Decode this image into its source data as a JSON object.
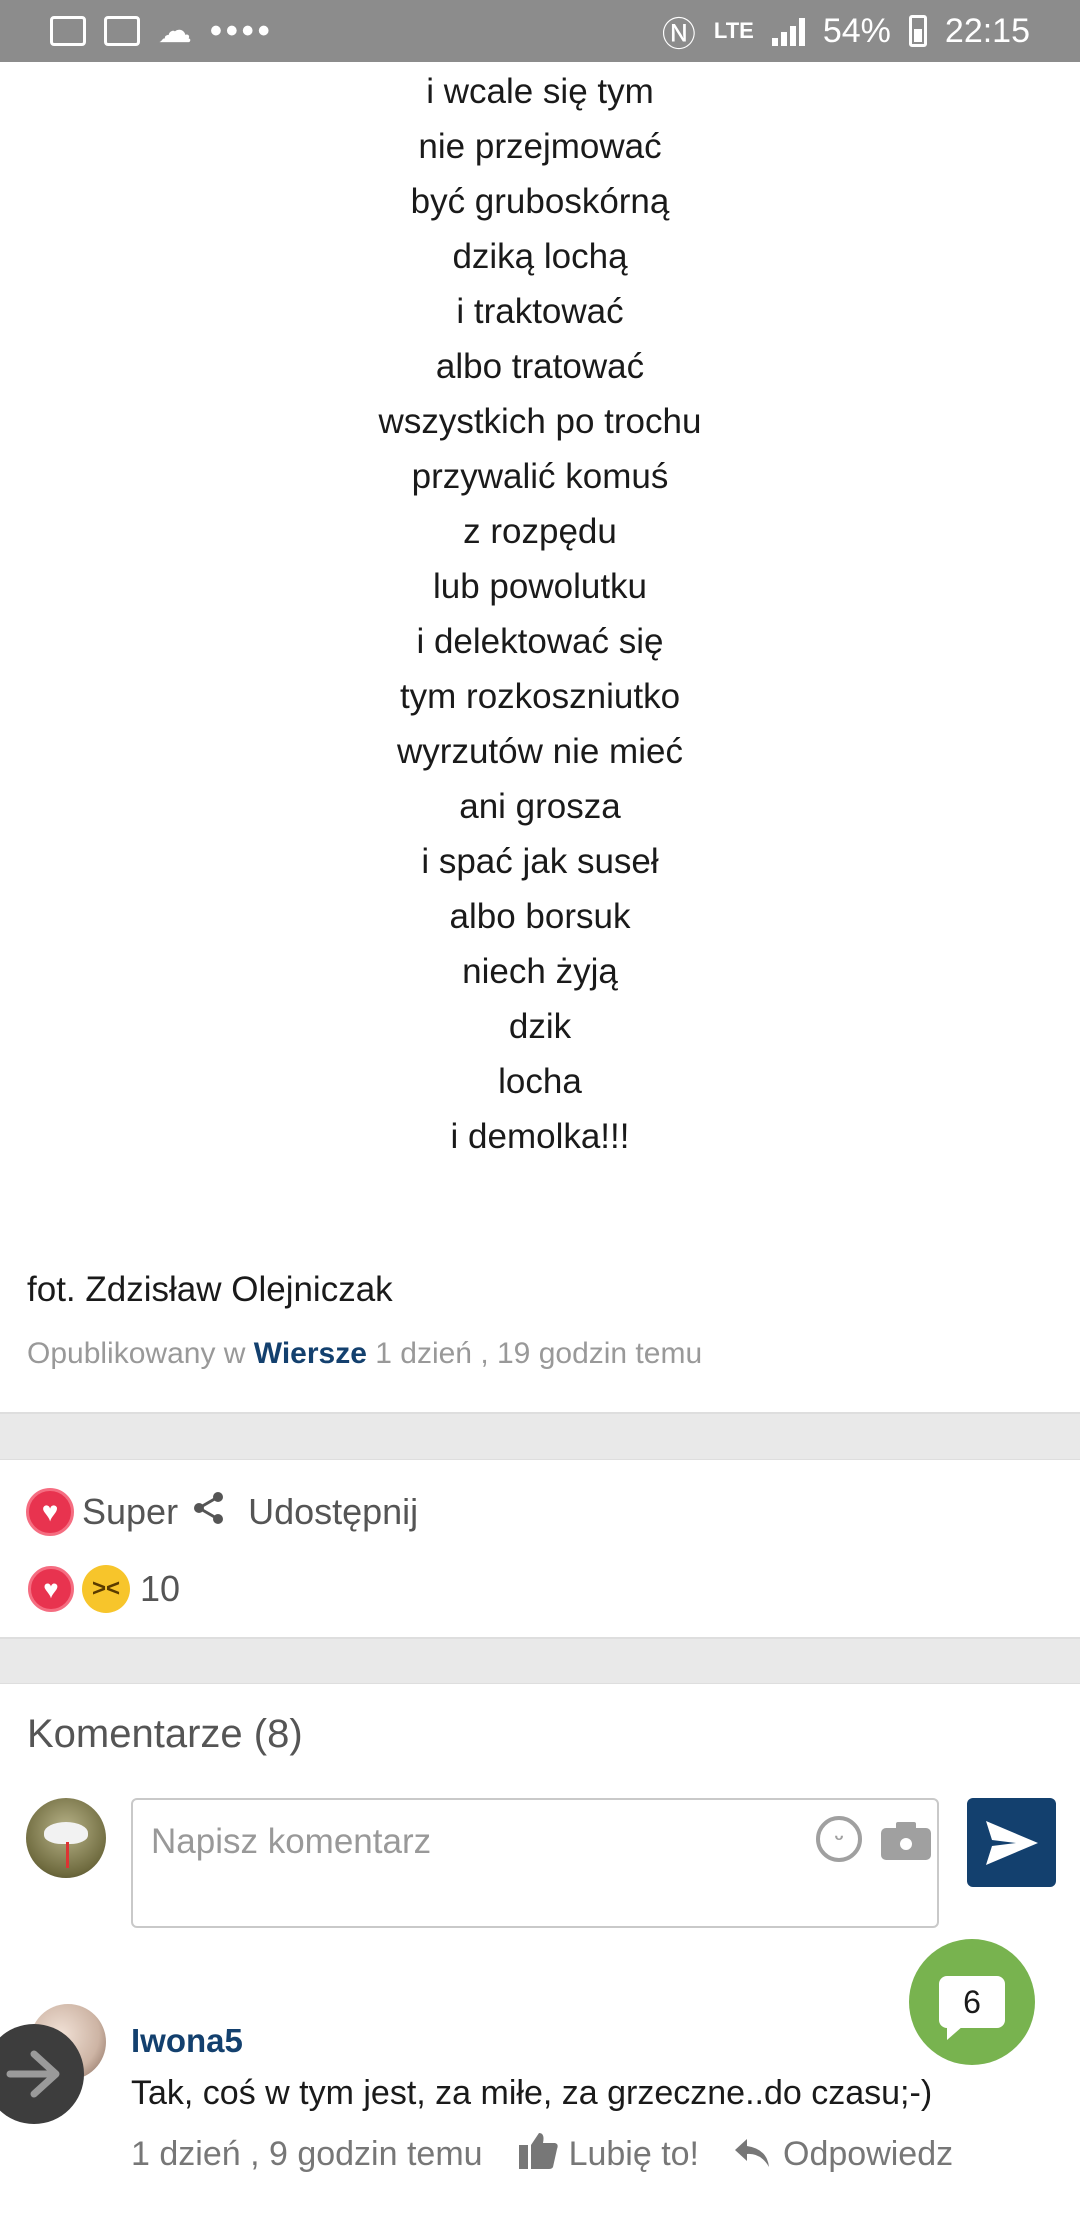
{
  "status_bar": {
    "dots": "••••",
    "lte": "LTE",
    "battery": "54%",
    "time": "22:15"
  },
  "poem": {
    "lines": [
      "i wcale się tym",
      "nie przejmować",
      "być gruboskórną",
      "dziką lochą",
      "i traktować",
      "albo tratować",
      "wszystkich po trochu",
      "przywalić komuś",
      "z rozpędu",
      "lub powolutku",
      "i delektować się",
      "tym rozkoszniutko",
      "wyrzutów nie mieć",
      "ani grosza",
      "i spać jak suseł",
      "albo borsuk",
      "niech żyją",
      "dzik",
      "locha",
      "i demolka!!!"
    ],
    "photo_credit": "fot. Zdzisław Olejniczak",
    "published_prefix": "Opublikowany w",
    "category": "Wiersze",
    "published_time": "1 dzień , 19 godzin temu"
  },
  "reactions": {
    "super_label": "Super",
    "share_label": "Udostępnij",
    "count": "10",
    "icons": [
      "heart-icon",
      "laugh-emoji-icon"
    ]
  },
  "comments": {
    "title": "Komentarze (8)",
    "input_placeholder": "Napisz komentarz",
    "items": [
      {
        "author": "Iwona5",
        "text": "Tak, coś w tym jest, za miłe, za grzeczne..do czasu;-)",
        "time": "1 dzień , 9 godzin temu",
        "like_label": "Lubię to!",
        "reply_label": "Odpowiedz"
      }
    ]
  },
  "chat_fab": {
    "count": "6"
  },
  "colors": {
    "brand_blue": "#13406e",
    "heart_red": "#e8334f",
    "chat_green": "#78b34f",
    "status_gray": "#8c8c8c"
  }
}
